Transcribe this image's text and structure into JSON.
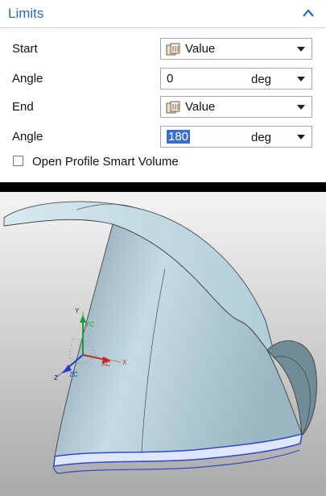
{
  "limits": {
    "title": "Limits",
    "start": {
      "label": "Start",
      "value": "Value"
    },
    "start_angle": {
      "label": "Angle",
      "value": "0",
      "unit": "deg"
    },
    "end": {
      "label": "End",
      "value": "Value"
    },
    "end_angle": {
      "label": "Angle",
      "value": "180",
      "unit": "deg"
    },
    "open_profile": {
      "label": "Open Profile Smart Volume",
      "checked": false
    }
  },
  "viewport": {
    "triad": {
      "y": "Y",
      "yc": "YC",
      "x": "X",
      "xc": "XC",
      "z": "Z",
      "zc": "ZC"
    }
  },
  "colors": {
    "accent": "#2b6cb0",
    "selection": "#3b6fc7",
    "model": "#b7d3de"
  }
}
